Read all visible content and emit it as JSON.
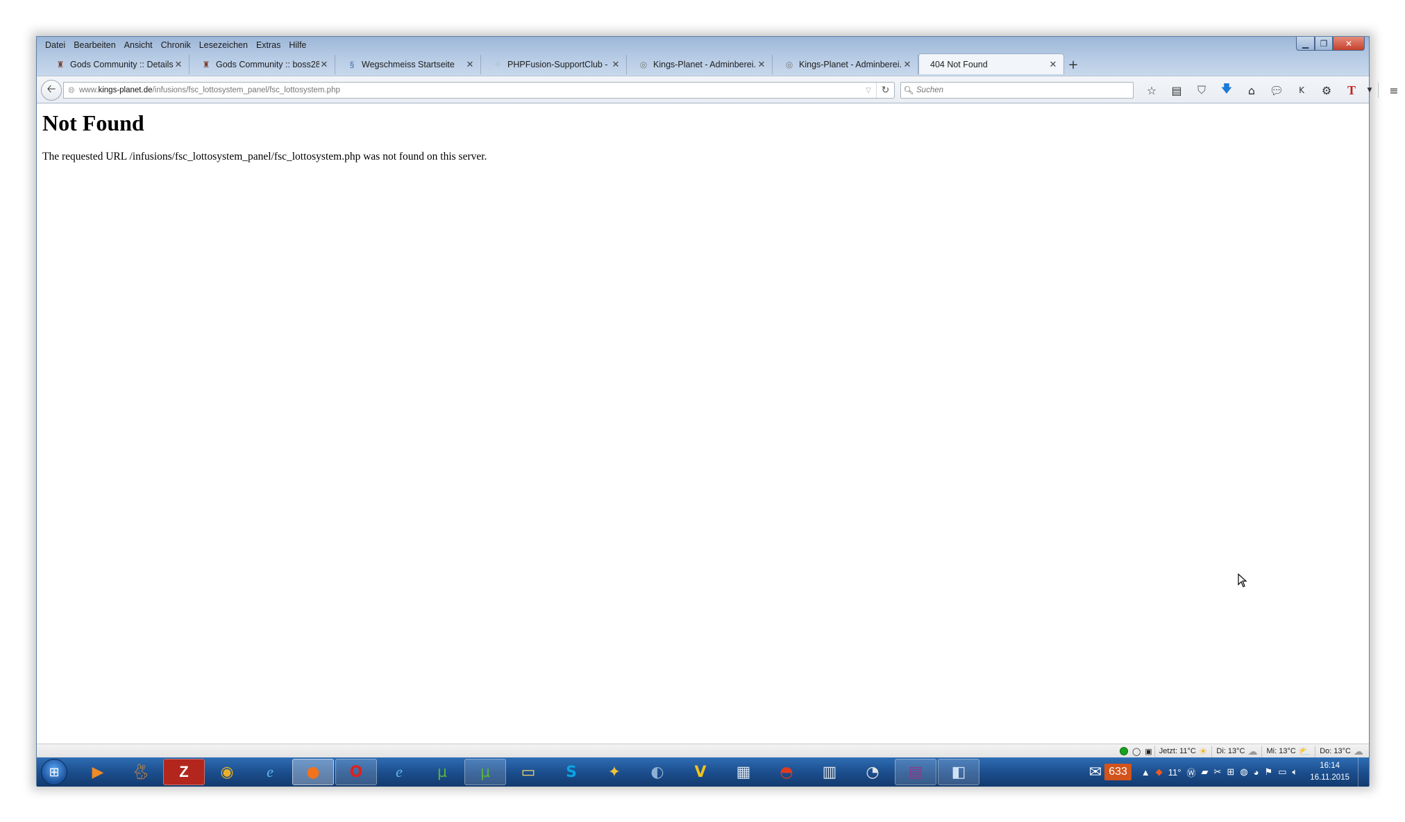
{
  "menubar": [
    "Datei",
    "Bearbeiten",
    "Ansicht",
    "Chronik",
    "Lesezeichen",
    "Extras",
    "Hilfe"
  ],
  "tabs": [
    {
      "label": "Gods Community :: Details...",
      "icon": "gods-favicon-icon"
    },
    {
      "label": "Gods Community :: boss28...",
      "icon": "gods-favicon-icon"
    },
    {
      "label": "Wegschmeiss Startseite",
      "icon": "wegschmeiss-favicon-icon"
    },
    {
      "label": "PHPFusion-SupportClub - ...",
      "icon": "phpfusion-favicon-icon"
    },
    {
      "label": "Kings-Planet - Adminberei...",
      "icon": "kingsplanet-favicon-icon"
    },
    {
      "label": "Kings-Planet - Adminberei...",
      "icon": "kingsplanet-favicon-icon"
    },
    {
      "label": "404 Not Found",
      "icon": "",
      "active": true
    }
  ],
  "url": {
    "prefix": "www.",
    "domain": "kings-planet.de",
    "path": "/infusions/fsc_lottosystem_panel/fsc_lottosystem.php"
  },
  "search": {
    "placeholder": "Suchen"
  },
  "page": {
    "heading": "Not Found",
    "message": "The requested URL /infusions/fsc_lottosystem_panel/fsc_lottosystem.php was not found on this server."
  },
  "statusbar": {
    "weather": [
      {
        "label": "Jetzt: 11°C",
        "icon": "sun-icon"
      },
      {
        "label": "Di: 13°C",
        "icon": "cloud-icon"
      },
      {
        "label": "Mi: 13°C",
        "icon": "partly-cloudy-icon"
      },
      {
        "label": "Do: 13°C",
        "icon": "rain-cloud-icon"
      }
    ]
  },
  "taskbar": {
    "mail_count": "633",
    "temperature": "11°",
    "time": "16:14",
    "date": "16.11.2015"
  },
  "colors": {
    "taskbar": "#1c4f8e",
    "accent": "#2e6db4",
    "mail_badge": "#d2531b"
  }
}
